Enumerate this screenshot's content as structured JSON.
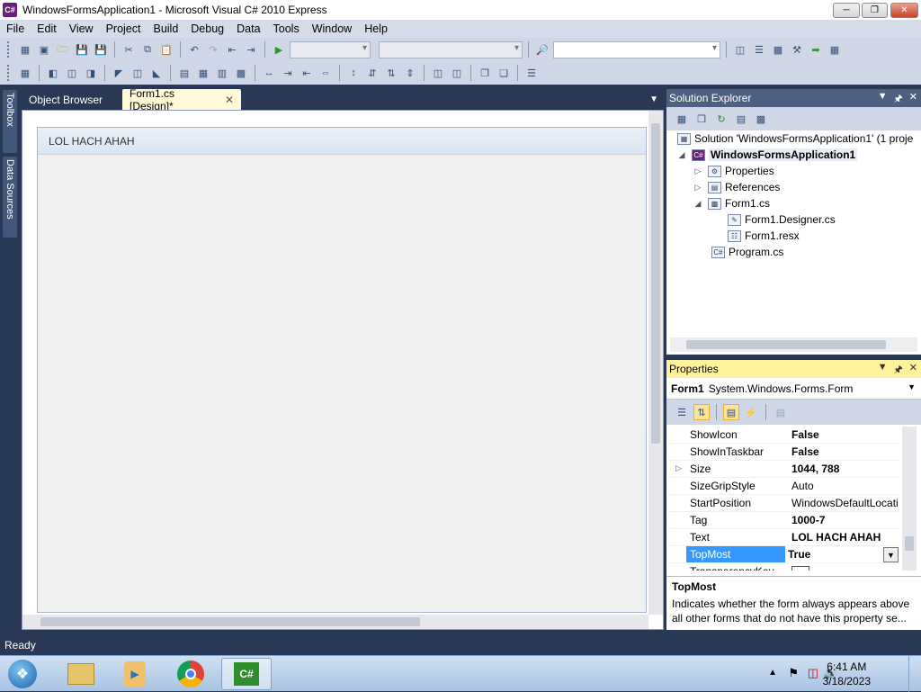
{
  "window": {
    "title": "WindowsFormsApplication1 - Microsoft Visual C# 2010 Express",
    "icon": "C#"
  },
  "menu": [
    "File",
    "Edit",
    "View",
    "Project",
    "Build",
    "Debug",
    "Data",
    "Tools",
    "Window",
    "Help"
  ],
  "side_tabs": {
    "toolbox": "Toolbox",
    "data_sources": "Data Sources"
  },
  "doc_tabs": {
    "object_browser": "Object Browser",
    "form_design": "Form1.cs [Design]*"
  },
  "form": {
    "caption": "LOL HACH AHAH"
  },
  "solution_explorer": {
    "title": "Solution Explorer",
    "solution": "Solution 'WindowsFormsApplication1' (1 proje",
    "project": "WindowsFormsApplication1",
    "items": {
      "properties": "Properties",
      "references": "References",
      "form1": "Form1.cs",
      "designer": "Form1.Designer.cs",
      "resx": "Form1.resx",
      "program": "Program.cs"
    }
  },
  "properties": {
    "title": "Properties",
    "object_name": "Form1",
    "object_type": "System.Windows.Forms.Form",
    "rows": [
      {
        "name": "ShowIcon",
        "value": "False"
      },
      {
        "name": "ShowInTaskbar",
        "value": "False"
      },
      {
        "name": "Size",
        "value": "1044, 788"
      },
      {
        "name": "SizeGripStyle",
        "value": "Auto"
      },
      {
        "name": "StartPosition",
        "value": "WindowsDefaultLocati"
      },
      {
        "name": "Tag",
        "value": "1000-7"
      },
      {
        "name": "Text",
        "value": "LOL HACH AHAH"
      },
      {
        "name": "TopMost",
        "value": "True"
      },
      {
        "name": "TransparencyKey",
        "value": ""
      }
    ],
    "description_title": "TopMost",
    "description": "Indicates whether the form always appears above all other forms that do not have this property se..."
  },
  "status": {
    "text": "Ready"
  },
  "clock": {
    "time": "6:41 AM",
    "date": "3/18/2023"
  },
  "colors": {
    "ide_bg": "#293955",
    "active_header": "#fff29d",
    "selection": "#3399ff"
  }
}
